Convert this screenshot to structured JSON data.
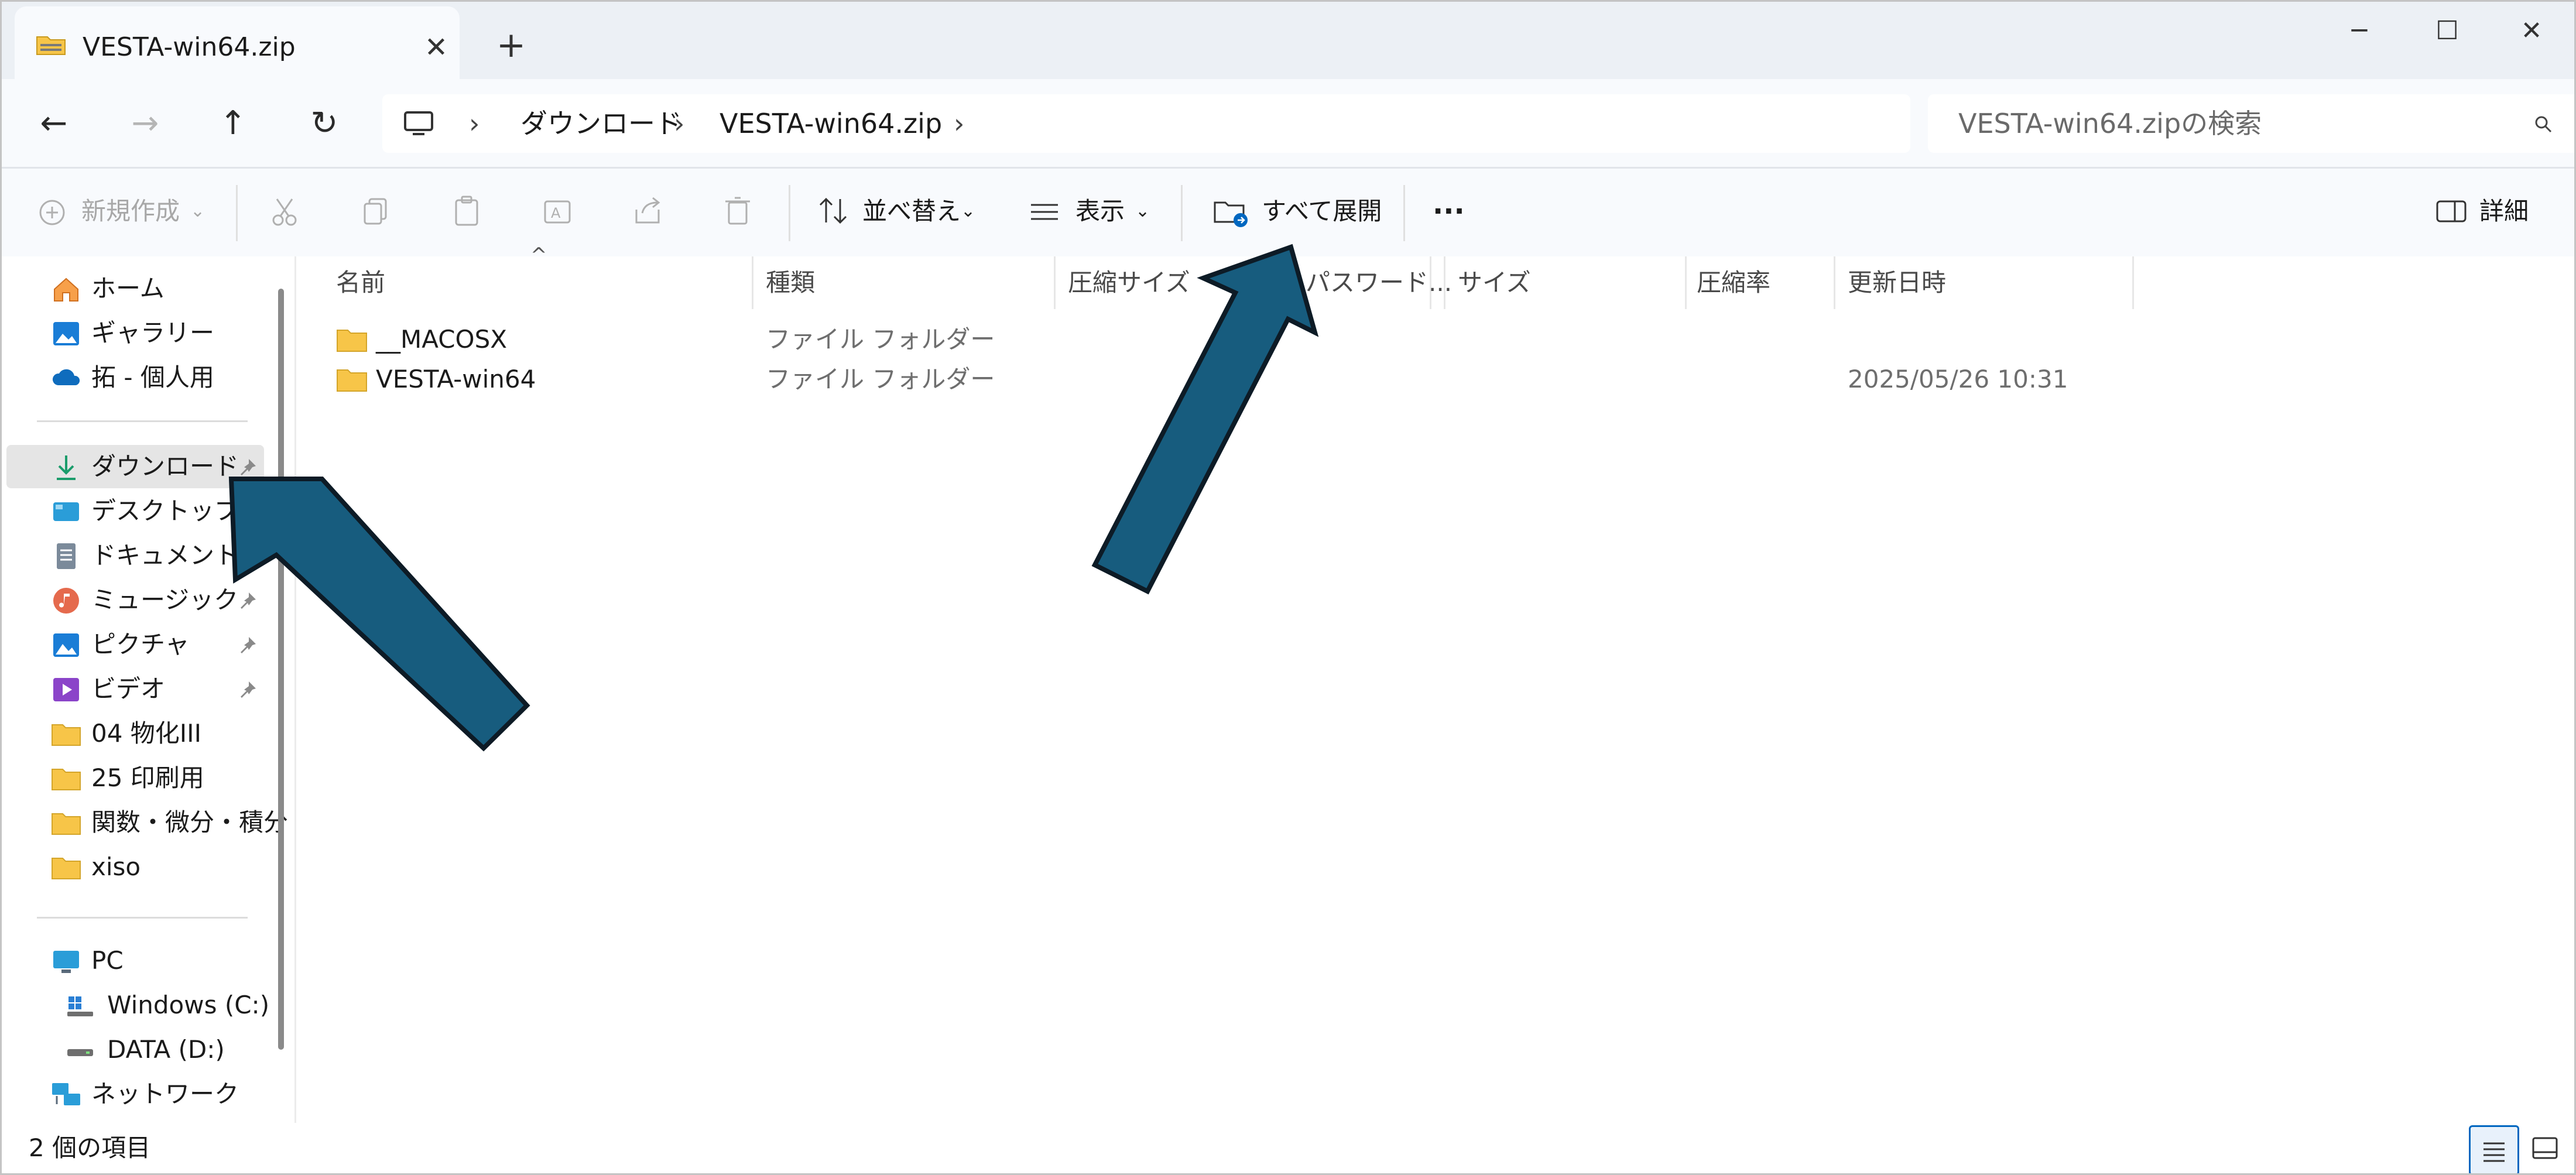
{
  "window": {
    "tab_title": "VESTA-win64.zip",
    "tab_close": "✕",
    "tab_add": "+",
    "minimize": "─",
    "maximize": "☐",
    "close": "✕"
  },
  "nav": {
    "back": "←",
    "forward": "→",
    "up": "↑",
    "refresh": "↻",
    "breadcrumb": [
      "ダウンロード",
      "VESTA-win64.zip"
    ],
    "separator": "›",
    "search_placeholder": "VESTA-win64.zipの検索"
  },
  "commands": {
    "new": "新規作成",
    "sort": "並べ替え",
    "view": "表示",
    "extract_all": "すべて展開",
    "more": "···",
    "details": "詳細"
  },
  "sidebar": {
    "quick": [
      {
        "label": "ホーム",
        "icon": "home-icon"
      },
      {
        "label": "ギャラリー",
        "icon": "gallery-icon"
      },
      {
        "label": "拓 - 個人用",
        "icon": "cloud-icon"
      }
    ],
    "pinned": [
      {
        "label": "ダウンロード",
        "icon": "download-icon",
        "pinned": true,
        "selected": true
      },
      {
        "label": "デスクトップ",
        "icon": "desktop-icon",
        "pinned": false
      },
      {
        "label": "ドキュメント",
        "icon": "document-icon",
        "pinned": false
      },
      {
        "label": "ミュージック",
        "icon": "music-icon",
        "pinned": true
      },
      {
        "label": "ピクチャ",
        "icon": "pictures-icon",
        "pinned": true
      },
      {
        "label": "ビデオ",
        "icon": "video-icon",
        "pinned": true
      },
      {
        "label": "04 物化III",
        "icon": "folder-icon"
      },
      {
        "label": "25 印刷用",
        "icon": "folder-icon"
      },
      {
        "label": "関数・微分・積分",
        "icon": "folder-icon"
      },
      {
        "label": "xiso",
        "icon": "folder-icon"
      }
    ],
    "devices": [
      {
        "label": "PC",
        "icon": "pc-icon"
      },
      {
        "label": "Windows (C:)",
        "icon": "windows-drive-icon"
      },
      {
        "label": "DATA (D:)",
        "icon": "drive-icon"
      },
      {
        "label": "ネットワーク",
        "icon": "network-icon"
      }
    ]
  },
  "columns": [
    "名前",
    "種類",
    "圧縮サイズ",
    "パスワード...",
    "サイズ",
    "圧縮率",
    "更新日時"
  ],
  "files": [
    {
      "name": "__MACOSX",
      "type": "ファイル フォルダー",
      "modified": ""
    },
    {
      "name": "VESTA-win64",
      "type": "ファイル フォルダー",
      "modified": "2025/05/26 10:31"
    }
  ],
  "status": {
    "item_count": "2 個の項目"
  },
  "colors": {
    "arrow_fill": "#175c7e",
    "arrow_stroke": "#0d1b26",
    "folder": "#f7c548",
    "accent": "#0067c0"
  }
}
